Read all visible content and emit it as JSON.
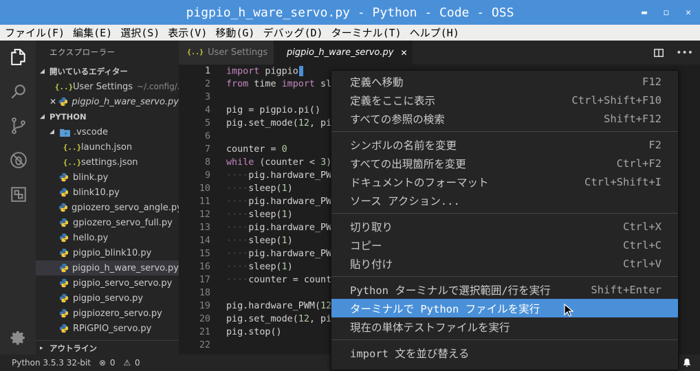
{
  "window": {
    "title": "pigpio_h_ware_servo.py - Python - Code - OSS"
  },
  "menubar": [
    "ファイル(F)",
    "編集(E)",
    "選択(S)",
    "表示(V)",
    "移動(G)",
    "デバッグ(D)",
    "ターミナル(T)",
    "ヘルプ(H)"
  ],
  "sidebar": {
    "title": "エクスプローラー",
    "open_editors": {
      "header": "開いているエディター",
      "items": [
        {
          "label": "User Settings",
          "detail": "~/.config/...",
          "icon": "json-icon"
        },
        {
          "label": "pigpio_h_ware_servo.py",
          "icon": "python-icon",
          "close": "✕"
        }
      ]
    },
    "folder": {
      "header": "PYTHON",
      "vscode_folder": ".vscode",
      "vscode_files": [
        "launch.json",
        "settings.json"
      ],
      "files": [
        "blink.py",
        "blink10.py",
        "gpiozero_servo_angle.py",
        "gpiozero_servo_full.py",
        "hello.py",
        "pigpio_blink10.py",
        "pigpio_h_ware_servo.py",
        "pigpio_servo_servo.py",
        "pigpio_servo.py",
        "pigpiozero_servo.py",
        "RPiGPIO_servo.py"
      ],
      "selected": "pigpio_h_ware_servo.py"
    },
    "outline": "アウトライン"
  },
  "tabs": [
    {
      "label": "User Settings",
      "icon": "json-icon",
      "active": false
    },
    {
      "label": "pigpio_h_ware_servo.py",
      "icon": "python-icon",
      "active": true,
      "close": "✕"
    }
  ],
  "editor": {
    "current_line": 1,
    "lines": [
      "import pigpio",
      "from time import sl",
      "",
      "pig = pigpio.pi()",
      "pig.set_mode(12, pi",
      "",
      "counter = 0",
      "while (counter < 3)",
      "····pig.hardware_PW",
      "····sleep(1)",
      "····pig.hardware_PW",
      "····sleep(1)",
      "····pig.hardware_PW",
      "····sleep(1)",
      "····pig.hardware_PW",
      "····sleep(1)",
      "····counter = count",
      "",
      "pig.hardware_PWM(12",
      "pig.set_mode(12, pi",
      "pig.stop()",
      ""
    ]
  },
  "context_menu": {
    "groups": [
      [
        {
          "label": "定義へ移動",
          "shortcut": "F12"
        },
        {
          "label": "定義をここに表示",
          "shortcut": "Ctrl+Shift+F10"
        },
        {
          "label": "すべての参照の検索",
          "shortcut": "Shift+F12"
        }
      ],
      [
        {
          "label": "シンボルの名前を変更",
          "shortcut": "F2"
        },
        {
          "label": "すべての出現箇所を変更",
          "shortcut": "Ctrl+F2"
        },
        {
          "label": "ドキュメントのフォーマット",
          "shortcut": "Ctrl+Shift+I"
        },
        {
          "label": "ソース アクション...",
          "shortcut": ""
        }
      ],
      [
        {
          "label": "切り取り",
          "shortcut": "Ctrl+X"
        },
        {
          "label": "コピー",
          "shortcut": "Ctrl+C"
        },
        {
          "label": "貼り付け",
          "shortcut": "Ctrl+V"
        }
      ],
      [
        {
          "label": "Python ターミナルで選択範囲/行を実行",
          "shortcut": "Shift+Enter"
        },
        {
          "label": "ターミナルで Python ファイルを実行",
          "shortcut": "",
          "highlighted": true
        },
        {
          "label": "現在の単体テストファイルを実行",
          "shortcut": ""
        }
      ],
      [
        {
          "label": "import 文を並び替える",
          "shortcut": ""
        }
      ]
    ]
  },
  "statusbar": {
    "interpreter": "Python 3.5.3 32-bit",
    "errors": "0",
    "warnings": "0"
  },
  "colors": {
    "accent": "#4a90d9",
    "keyword": "#c586c0",
    "number": "#b5cea8",
    "editor_bg": "#1e1e1e"
  }
}
